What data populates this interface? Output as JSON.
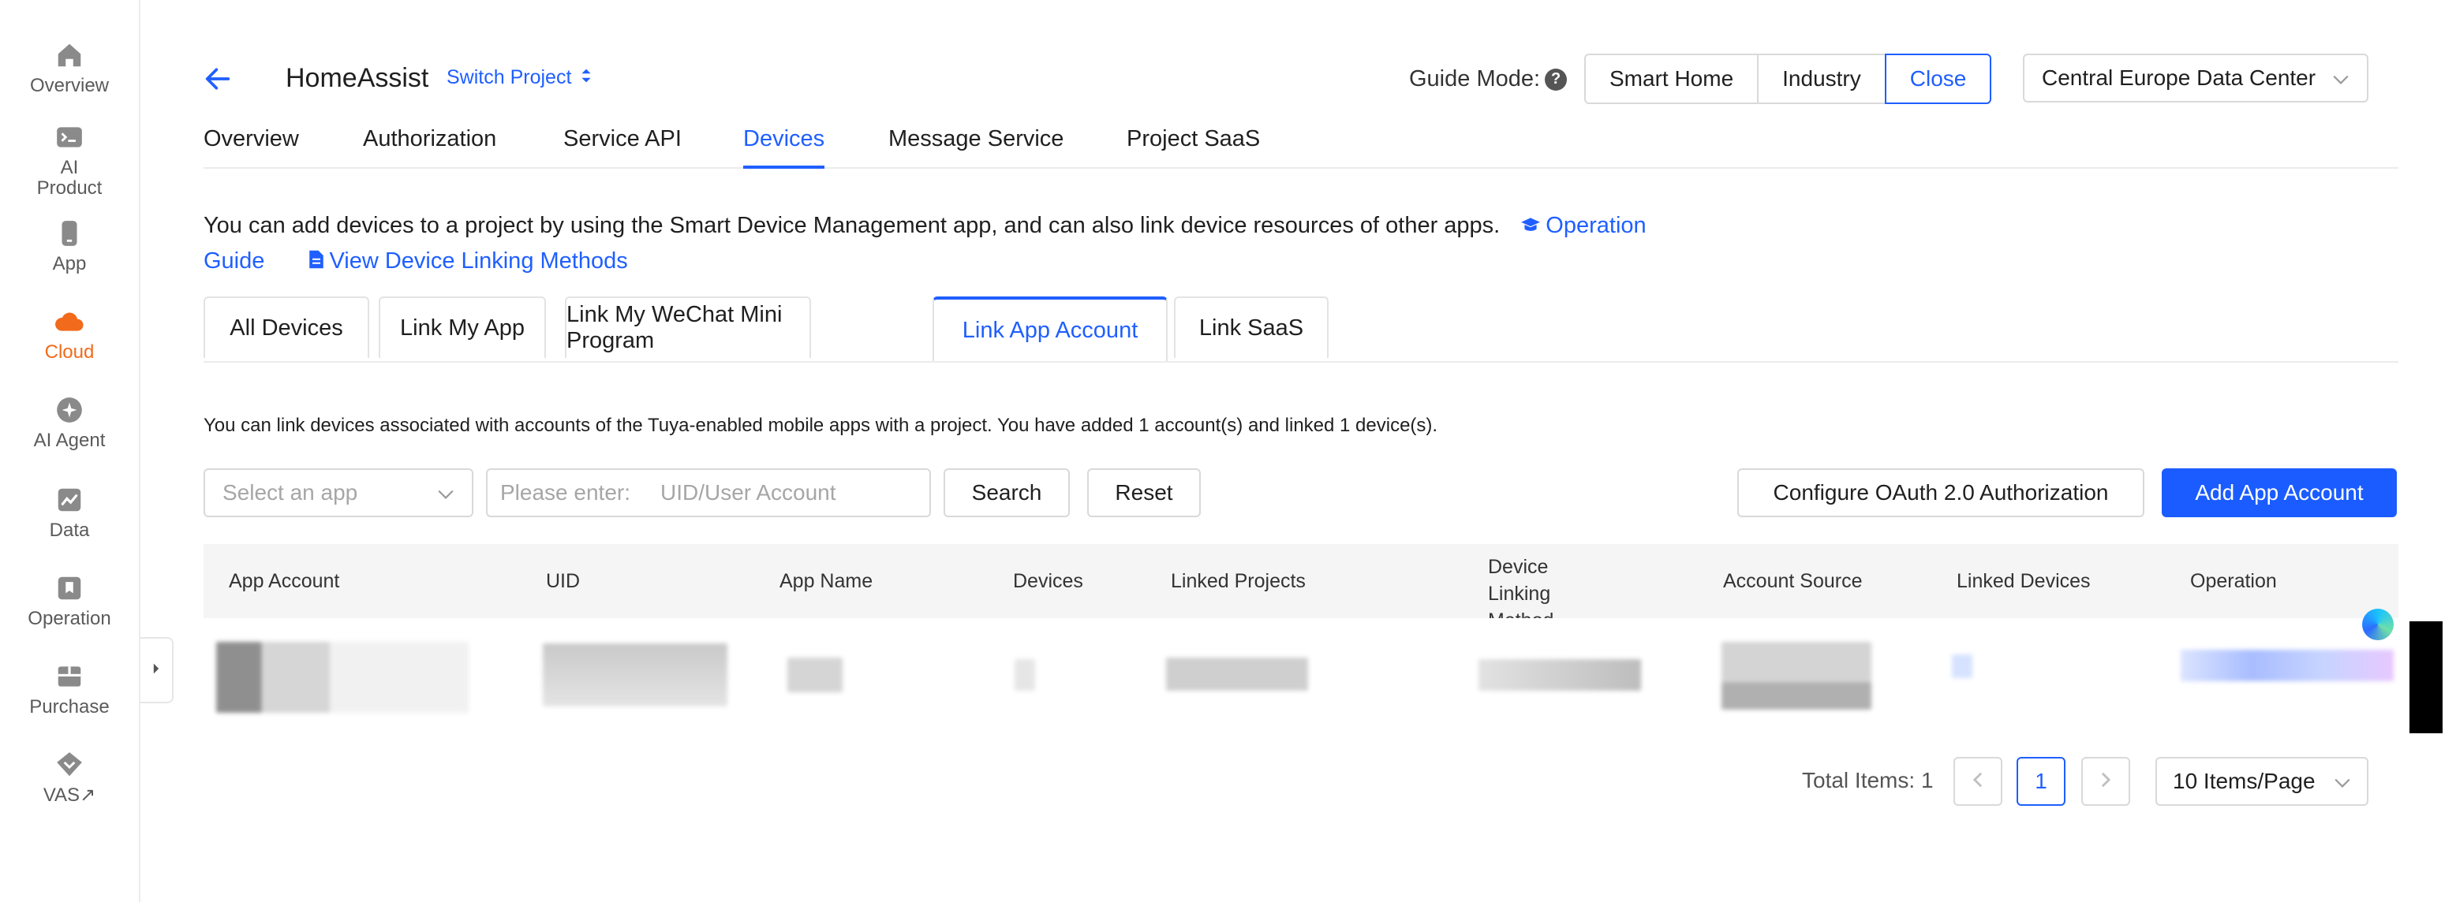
{
  "sidebar": {
    "items": [
      {
        "label": "Overview",
        "icon": "house-icon",
        "active": false
      },
      {
        "label": "AI Product",
        "icon": "terminal-icon",
        "active": false
      },
      {
        "label": "App",
        "icon": "phone-icon",
        "active": false
      },
      {
        "label": "Cloud",
        "icon": "cloud-icon",
        "active": true
      },
      {
        "label": "AI Agent",
        "icon": "sparkle-icon",
        "active": false
      },
      {
        "label": "Data",
        "icon": "chart-icon",
        "active": false
      },
      {
        "label": "Operation",
        "icon": "bookmark-icon",
        "active": false
      },
      {
        "label": "Purchase",
        "icon": "box-icon",
        "active": false
      },
      {
        "label": "VAS",
        "icon": "diamond-icon",
        "active": false,
        "external": "↗"
      }
    ],
    "collapse_icon": "chevron-right-icon"
  },
  "header": {
    "title": "HomeAssist",
    "switch_label": "Switch Project",
    "guide_mode_label": "Guide Mode:",
    "guide_help": "?",
    "modes": [
      "Smart Home",
      "Industry",
      "Close"
    ],
    "active_mode": "Close",
    "data_center": "Central Europe Data Center"
  },
  "nav": {
    "tabs": [
      "Overview",
      "Authorization",
      "Service API",
      "Devices",
      "Message Service",
      "Project SaaS"
    ],
    "active": "Devices"
  },
  "info": {
    "text": "You can add devices to a project by using the Smart Device Management app, and can also link device resources of other apps.",
    "guide_link_a": "Operation",
    "guide_link_b": "Guide",
    "linking_link": "View Device Linking Methods"
  },
  "subtabs": {
    "items": [
      "All Devices",
      "Link My App",
      "Link My WeChat Mini Program",
      "Link App Account",
      "Link SaaS"
    ],
    "active": "Link App Account"
  },
  "description": "You can link devices associated with accounts of the Tuya-enabled mobile apps with a project. You have added 1 account(s) and linked 1 device(s).",
  "filters": {
    "app_placeholder": "Select an app",
    "uid_prefix": "Please enter:",
    "uid_placeholder": "UID/User Account",
    "search_label": "Search",
    "reset_label": "Reset",
    "oauth_label": "Configure OAuth 2.0 Authorization",
    "add_label": "Add App Account"
  },
  "table": {
    "columns": [
      "App Account",
      "UID",
      "App Name",
      "Devices",
      "Linked Projects",
      "Device Linking Method",
      "Account Source",
      "Linked Devices",
      "Operation"
    ],
    "rows_blurred": 1
  },
  "pagination": {
    "total_label": "Total Items: 1",
    "current_page": "1",
    "page_size": "10 Items/Page"
  },
  "colors": {
    "accent": "#1f5fff",
    "active_rail": "#f26a1b",
    "primary_button": "#1a5cff"
  }
}
